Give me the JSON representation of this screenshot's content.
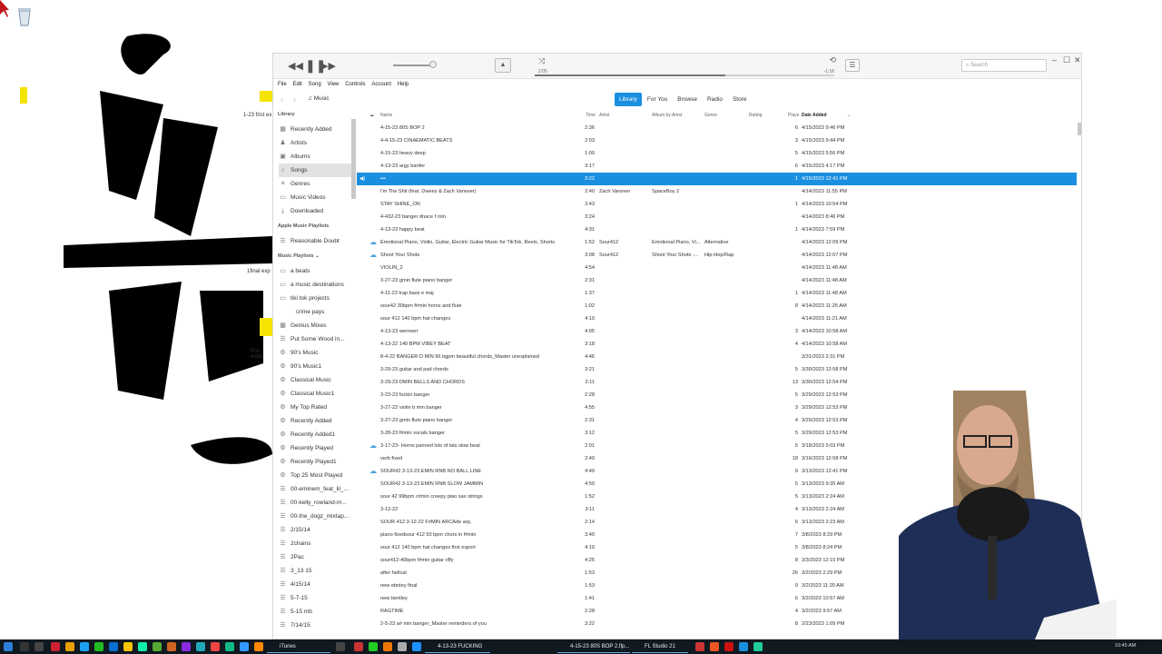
{
  "desktop": {
    "labels": [
      "1-23 first ex",
      "1final exp",
      "first expo"
    ]
  },
  "window": {
    "time_elapsed": "2:05",
    "time_remaining": "-1:16",
    "search_placeholder": "Search",
    "minimize": "–",
    "maximize": "☐",
    "close": "✕"
  },
  "menu": [
    "File",
    "Edit",
    "Song",
    "View",
    "Controls",
    "Account",
    "Help"
  ],
  "nav": {
    "media_label": "Music",
    "tabs": [
      "Library",
      "For You",
      "Browse",
      "Radio",
      "Store"
    ]
  },
  "sidebar": {
    "library_heading": "Library",
    "library": [
      "Recently Added",
      "Artists",
      "Albums",
      "Songs",
      "Genres",
      "Music Videos",
      "Downloaded"
    ],
    "apple_heading": "Apple Music Playlists",
    "apple": [
      "Reasonable Doubt"
    ],
    "playlists_heading": "Music Playlists ⌄",
    "playlists": [
      "a beats",
      "a music destinations",
      "tiki tok projects",
      "crime pays",
      "Genius Mixes",
      "Put Some Wood in...",
      "90's Music",
      "90's Music1",
      "Classical Music",
      "Classical Music1",
      "My Top Rated",
      "Recently Added",
      "Recently Added1",
      "Recently Played",
      "Recently Played1",
      "Top 25 Most Played",
      "00-eminem_feat_lil_...",
      "00-kelly_rowland-m...",
      "00-the_dogz_mixtap...",
      "2/15/14",
      "2chains",
      "2Pac",
      "3_13 15",
      "4/15/14",
      "5-7-15",
      "5-15 mb",
      "7/14/15"
    ]
  },
  "columns": {
    "name": "Name",
    "time": "Time",
    "artist": "Artist",
    "album_artist": "Album by Artist",
    "genre": "Genre",
    "rating": "Rating",
    "plays": "Plays",
    "date_added": "Date Added"
  },
  "songs": [
    {
      "name": "4-15-23 80S BOP 2",
      "time": "2:36",
      "artist": "",
      "album": "",
      "genre": "",
      "plays": "6",
      "date": "4/15/2023 9:46 PM"
    },
    {
      "name": "4-4-15-23 CINAEMATIC BEATS",
      "time": "2:03",
      "artist": "",
      "album": "",
      "genre": "",
      "plays": "3",
      "date": "4/15/2023 9:44 PM"
    },
    {
      "name": "4-15-23 heavy deep",
      "time": "1:09",
      "artist": "",
      "album": "",
      "genre": "",
      "plays": "5",
      "date": "4/15/2023 5:56 PM"
    },
    {
      "name": "4-13-23 argy banfer",
      "time": "3:17",
      "artist": "",
      "album": "",
      "genre": "",
      "plays": "6",
      "date": "4/15/2023 4:17 PM"
    },
    {
      "name": "•••",
      "time": "3:22",
      "artist": "",
      "album": "",
      "genre": "",
      "plays": "1",
      "date": "4/15/2023 12:41 PM",
      "playing": true
    },
    {
      "name": "I'm The Shit (feat. Dweez & Zach Vanover)",
      "time": "2:40",
      "artist": "Zach Vanover",
      "album": "SpaceBoy 2",
      "genre": "",
      "plays": "",
      "date": "4/14/2023 11:55 PM"
    },
    {
      "name": "STAY SHINE_ON",
      "time": "3:43",
      "artist": "",
      "album": "",
      "genre": "",
      "plays": "1",
      "date": "4/14/2023 10:54 PM"
    },
    {
      "name": "4-432-23 banger dnace f min",
      "time": "3:24",
      "artist": "",
      "album": "",
      "genre": "",
      "plays": "",
      "date": "4/14/2023 8:46 PM"
    },
    {
      "name": "4-13-23 happy beat",
      "time": "4:31",
      "artist": "",
      "album": "",
      "genre": "",
      "plays": "1",
      "date": "4/14/2023 7:59 PM"
    },
    {
      "name": "Emotional Piano, Violin, Guitar, Electric Guitar Music for TikTok, Reels, Shorts",
      "time": "1:52",
      "artist": "Sour412",
      "album": "Emotional Piano, Vi...",
      "genre": "Alternative",
      "plays": "",
      "date": "4/14/2023 12:09 PM",
      "cloud": true
    },
    {
      "name": "Shoot Your Shots",
      "time": "3:08",
      "artist": "Sour412",
      "album": "Shoot Your Shots -...",
      "genre": "Hip-Hop/Rap",
      "plays": "",
      "date": "4/14/2023 12:07 PM",
      "cloud": true
    },
    {
      "name": "VIOLIN_2",
      "time": "4:54",
      "artist": "",
      "album": "",
      "genre": "",
      "plays": "",
      "date": "4/14/2023 11:48 AM"
    },
    {
      "name": "3-27-23 gmin flute piano banger",
      "time": "2:31",
      "artist": "",
      "album": "",
      "genre": "",
      "plays": "",
      "date": "4/14/2023 11:48 AM"
    },
    {
      "name": "4-11-23 trap bass e maj",
      "time": "1:37",
      "artist": "",
      "album": "",
      "genre": "",
      "plays": "1",
      "date": "4/14/2023 11:48 AM"
    },
    {
      "name": "sour42 30bpm f#min horns and flute",
      "time": "1:02",
      "artist": "",
      "album": "",
      "genre": "",
      "plays": "8",
      "date": "4/14/2023 11:25 AM"
    },
    {
      "name": "sour 412 140 bpm hat changes",
      "time": "4:10",
      "artist": "",
      "album": "",
      "genre": "",
      "plays": "",
      "date": "4/14/2023 11:21 AM"
    },
    {
      "name": "4-13-23 werreerr",
      "time": "4:05",
      "artist": "",
      "album": "",
      "genre": "",
      "plays": "3",
      "date": "4/14/2023 10:58 AM"
    },
    {
      "name": "4-13-22 140 BPM VIBEY BEAT",
      "time": "3:18",
      "artist": "",
      "album": "",
      "genre": "",
      "plays": "4",
      "date": "4/14/2023 10:58 AM"
    },
    {
      "name": "8-4-22 BANGER D MIN 96 bgpm beautiful chords_Master unexplained",
      "time": "4:46",
      "artist": "",
      "album": "",
      "genre": "",
      "plays": "",
      "date": "3/31/2023 2:31 PM"
    },
    {
      "name": "3-29-23 guitar and pad chords",
      "time": "3:21",
      "artist": "",
      "album": "",
      "genre": "",
      "plays": "5",
      "date": "3/30/2023 12:58 PM"
    },
    {
      "name": "3-29-23 DMIN BELLS AND CHORDS",
      "time": "2:11",
      "artist": "",
      "album": "",
      "genre": "",
      "plays": "13",
      "date": "3/30/2023 12:54 PM"
    },
    {
      "name": "3-23-23 fuckin banger",
      "time": "2:28",
      "artist": "",
      "album": "",
      "genre": "",
      "plays": "5",
      "date": "3/29/2023 12:53 PM"
    },
    {
      "name": "3-27-22 violin b min banger",
      "time": "4:55",
      "artist": "",
      "album": "",
      "genre": "",
      "plays": "3",
      "date": "3/29/2023 12:53 PM"
    },
    {
      "name": "3-27-23 gmin flute piano banger",
      "time": "2:31",
      "artist": "",
      "album": "",
      "genre": "",
      "plays": "4",
      "date": "3/29/2023 12:53 PM"
    },
    {
      "name": "3-28-23 f#min vocals banger",
      "time": "3:12",
      "artist": "",
      "album": "",
      "genre": "",
      "plays": "5",
      "date": "3/29/2023 12:53 PM"
    },
    {
      "name": "3-17-23- Horns panned lots of lats slow beat",
      "time": "2:01",
      "artist": "",
      "album": "",
      "genre": "",
      "plays": "5",
      "date": "3/18/2023 5:03 PM",
      "cloud": true
    },
    {
      "name": "verb fixed",
      "time": "2:49",
      "artist": "",
      "album": "",
      "genre": "",
      "plays": "18",
      "date": "3/16/2023 12:58 PM"
    },
    {
      "name": "SOUR42 3-13-23 EMIN RNB NO BALL LINE",
      "time": "4:49",
      "artist": "",
      "album": "",
      "genre": "",
      "plays": "9",
      "date": "3/13/2023 12:41 PM",
      "cloud": true
    },
    {
      "name": "SOUR42 3-13-23 EMIN RNB SLOW JAMMIN",
      "time": "4:50",
      "artist": "",
      "album": "",
      "genre": "",
      "plays": "5",
      "date": "3/13/2023 9:35 AM"
    },
    {
      "name": "sour 42 99bpm c#min creepy piao sax strings",
      "time": "1:52",
      "artist": "",
      "album": "",
      "genre": "",
      "plays": "5",
      "date": "3/13/2023 2:24 AM"
    },
    {
      "name": "3-12-22",
      "time": "3:11",
      "artist": "",
      "album": "",
      "genre": "",
      "plays": "4",
      "date": "3/13/2023 2:24 AM"
    },
    {
      "name": "SOUR 412 3-12-22 F#MIN ARCAde arp,",
      "time": "2:14",
      "artist": "",
      "album": "",
      "genre": "",
      "plays": "6",
      "date": "3/13/2023 2:23 AM"
    },
    {
      "name": "piano fixedsour 412 93 bpm chors in f#min",
      "time": "3:40",
      "artist": "",
      "album": "",
      "genre": "",
      "plays": "7",
      "date": "3/8/2023 8:29 PM"
    },
    {
      "name": "sour 412 140 bpm hat changes first export",
      "time": "4:10",
      "artist": "",
      "album": "",
      "genre": "",
      "plays": "5",
      "date": "3/8/2023 8:24 PM"
    },
    {
      "name": "sour412-40bpm f#min guitar riffy",
      "time": "4:25",
      "artist": "",
      "album": "",
      "genre": "",
      "plays": "8",
      "date": "3/3/2023 12:15 PM"
    },
    {
      "name": "after hellcat",
      "time": "1:53",
      "artist": "",
      "album": "",
      "genre": "",
      "plays": "26",
      "date": "3/2/2023 2:29 PM"
    },
    {
      "name": "new ebntey final",
      "time": "1:53",
      "artist": "",
      "album": "",
      "genre": "",
      "plays": "9",
      "date": "3/2/2023 11:20 AM"
    },
    {
      "name": "new bentley",
      "time": "1:41",
      "artist": "",
      "album": "",
      "genre": "",
      "plays": "6",
      "date": "3/2/2023 10:57 AM"
    },
    {
      "name": "RAGTIME",
      "time": "2:28",
      "artist": "",
      "album": "",
      "genre": "",
      "plays": "4",
      "date": "3/2/2023 9:57 AM"
    },
    {
      "name": "2-5-23 a# min banger_Master reminders of you",
      "time": "3:22",
      "artist": "",
      "album": "",
      "genre": "",
      "plays": "8",
      "date": "2/23/2023 1:09 PM"
    }
  ],
  "taskbar": {
    "tasks": [
      "iTunes",
      "4-13-23 FUCKING CR...",
      "4-15-23 80S BOP 2.flp...",
      "FL Studio 21"
    ],
    "clock": "10:45 AM"
  }
}
